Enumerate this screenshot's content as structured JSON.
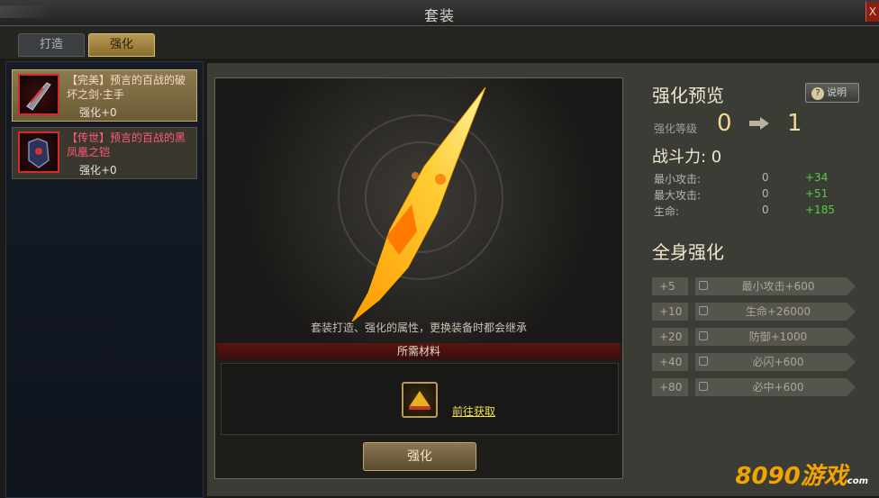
{
  "window": {
    "title": "套装",
    "close": "X"
  },
  "tabs": [
    {
      "label": "打造"
    },
    {
      "label": "强化"
    }
  ],
  "items": [
    {
      "name": "【完美】预言的百战的破坏之剑·主手",
      "level": "强化+0"
    },
    {
      "name": "【传世】预言的百战的黑凤凰之铠",
      "level": "强化+0"
    }
  ],
  "showcase": {
    "note": "套装打造、强化的属性，更换装备时都会继承"
  },
  "materials": {
    "header": "所需材料",
    "link": "前往获取"
  },
  "action": {
    "button": "强化"
  },
  "preview": {
    "title": "强化预览",
    "explain": "说明",
    "level_label": "强化等级",
    "level_from": "0",
    "level_to": "1",
    "power": "战斗力: 0",
    "stats": [
      {
        "label": "最小攻击:",
        "value": "0",
        "gain": "+34"
      },
      {
        "label": "最大攻击:",
        "value": "0",
        "gain": "+51"
      },
      {
        "label": "生命:",
        "value": "0",
        "gain": "+185"
      }
    ]
  },
  "fullbody": {
    "title": "全身强化",
    "bonuses": [
      {
        "level": "+5",
        "text": "最小攻击+600"
      },
      {
        "level": "+10",
        "text": "生命+26000"
      },
      {
        "level": "+20",
        "text": "防御+1000"
      },
      {
        "level": "+40",
        "text": "必闪+600"
      },
      {
        "level": "+80",
        "text": "必中+600"
      }
    ]
  },
  "watermark": {
    "brand": "8090游戏",
    "sub": "com"
  },
  "colors": {
    "accent": "#c9ad6a",
    "gain": "#4fcf40",
    "link": "#f0e24b",
    "rare": "#ff5a7a"
  }
}
